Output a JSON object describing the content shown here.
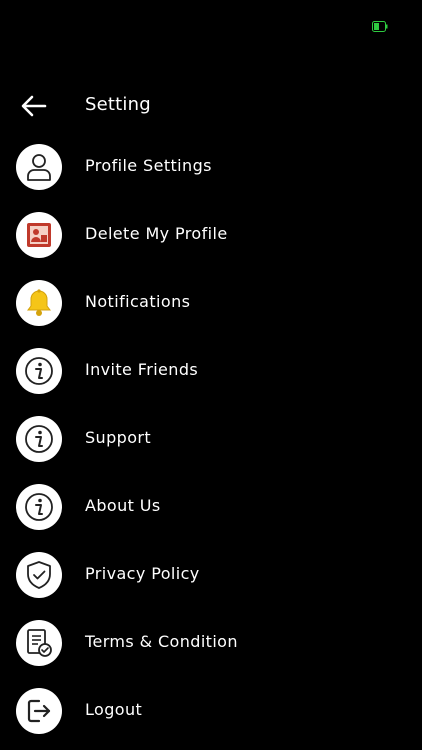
{
  "header": {
    "title": "Setting"
  },
  "status_bar": {
    "battery_color": "#2ecc40"
  },
  "menu": {
    "items": [
      {
        "label": "Profile Settings",
        "icon": "user-icon"
      },
      {
        "label": "Delete My Profile",
        "icon": "delete-profile-icon"
      },
      {
        "label": "Notifications",
        "icon": "bell-icon"
      },
      {
        "label": "Invite Friends",
        "icon": "info-icon"
      },
      {
        "label": "Support",
        "icon": "info-icon"
      },
      {
        "label": "About Us",
        "icon": "info-icon"
      },
      {
        "label": "Privacy Policy",
        "icon": "shield-check-icon"
      },
      {
        "label": "Terms & Condition",
        "icon": "document-check-icon"
      },
      {
        "label": "Logout",
        "icon": "logout-icon"
      }
    ]
  }
}
